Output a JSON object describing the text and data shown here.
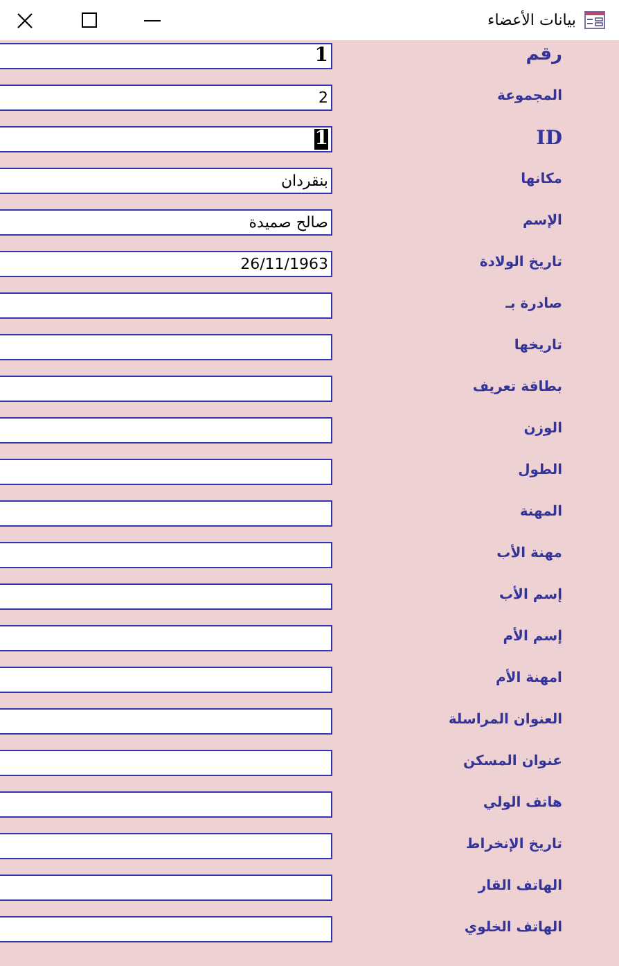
{
  "window": {
    "title": "بيانات الأعضاء"
  },
  "fields": [
    {
      "kind": "title",
      "label": "رقم",
      "value": "1",
      "selected": false
    },
    {
      "kind": "text",
      "label": "المجموعة",
      "value": "2",
      "selected": false
    },
    {
      "kind": "id",
      "label": "ID",
      "value": "1",
      "selected": true
    },
    {
      "kind": "text",
      "label": "مكانها",
      "value": "بنقردان",
      "selected": false
    },
    {
      "kind": "text",
      "label": "الإسم",
      "value": "صالح صميدة",
      "selected": false
    },
    {
      "kind": "text",
      "label": "تاريخ الولادة",
      "value": "26/11/1963",
      "selected": false
    },
    {
      "kind": "text",
      "label": "صادرة بـ",
      "selected": false
    },
    {
      "kind": "text",
      "label": "تاريخها",
      "selected": false
    },
    {
      "kind": "text",
      "label": "بطاقة تعريف",
      "selected": false
    },
    {
      "kind": "text",
      "label": "الوزن",
      "selected": false
    },
    {
      "kind": "text",
      "label": "الطول",
      "selected": false
    },
    {
      "kind": "text",
      "label": "المهنة",
      "selected": false
    },
    {
      "kind": "text",
      "label": "مهنة الأب",
      "selected": false
    },
    {
      "kind": "text",
      "label": "إسم الأب",
      "selected": false
    },
    {
      "kind": "text",
      "label": "إسم الأم",
      "selected": false
    },
    {
      "kind": "text",
      "label": "امهنة الأم",
      "selected": false
    },
    {
      "kind": "text",
      "label": "العنوان المراسلة",
      "selected": false
    },
    {
      "kind": "text",
      "label": "عنوان المسكن",
      "selected": false
    },
    {
      "kind": "text",
      "label": "هاتف الولي",
      "selected": false
    },
    {
      "kind": "text",
      "label": "تاريخ الإنخراط",
      "selected": false
    },
    {
      "kind": "text",
      "label": "الهاتف القار",
      "selected": false
    },
    {
      "kind": "text",
      "label": "الهاتف الخلوي",
      "selected": false
    }
  ]
}
